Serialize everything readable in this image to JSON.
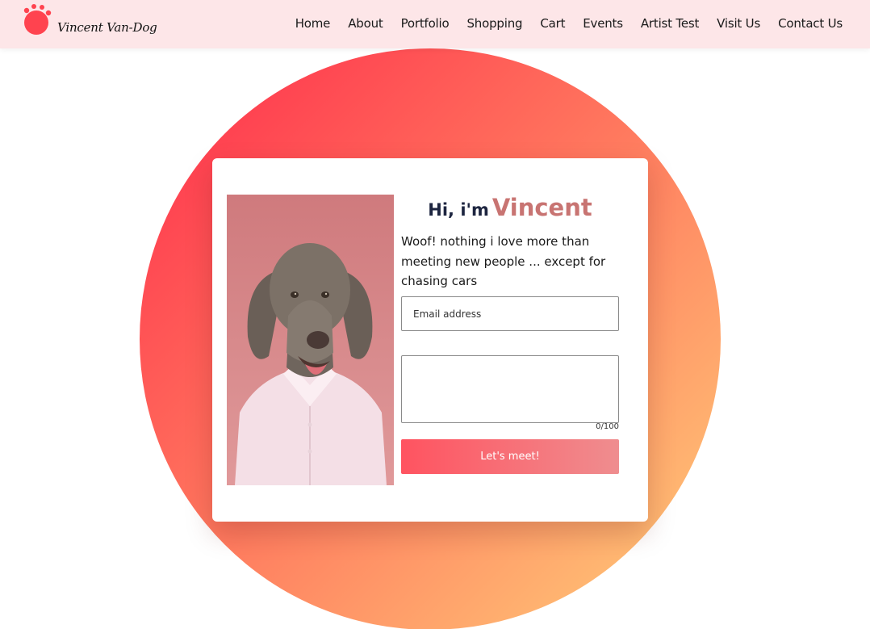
{
  "header": {
    "logo_text": "Vincent Van-Dog",
    "nav": [
      {
        "label": "Home"
      },
      {
        "label": "About"
      },
      {
        "label": "Portfolio"
      },
      {
        "label": "Shopping"
      },
      {
        "label": "Cart"
      },
      {
        "label": "Events"
      },
      {
        "label": "Artist Test"
      },
      {
        "label": "Visit Us"
      },
      {
        "label": "Contact Us"
      }
    ]
  },
  "hero": {
    "greeting_prefix": "Hi, i'm",
    "greeting_name": "Vincent",
    "bio": "Woof! nothing i love more than meeting new people ... except for chasing cars"
  },
  "form": {
    "email_placeholder": "Email address",
    "email_value": "",
    "message_value": "",
    "char_counter": "0/100",
    "submit_label": "Let's meet!"
  },
  "colors": {
    "header_bg": "#fde6e8",
    "accent": "#ff4f5a",
    "name_color": "#c87472",
    "heading_color": "#1d2540"
  }
}
